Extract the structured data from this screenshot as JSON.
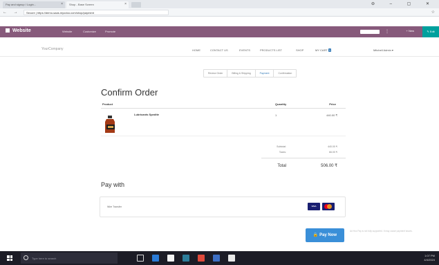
{
  "browser": {
    "tabs": [
      {
        "label": "Pay and signup / Login..."
      },
      {
        "label": "Shop - Base Screen"
      }
    ],
    "nav_buttons": "←  →  ⟳",
    "address": "Secure | https://demo-saas.myodoo.com/shop/payment",
    "window_controls": "⊖  –  ▢  ✕"
  },
  "odoo_bar": {
    "app_name": "Website",
    "menus": [
      "Website",
      "Customize",
      "Promote"
    ],
    "new_label": "+ New",
    "edit_label": "✎ Edit"
  },
  "site": {
    "logo": "YourCompany",
    "nav": [
      "Home",
      "Contact us",
      "Events",
      "Products List",
      "Shop"
    ],
    "cart_label": "My Cart",
    "cart_count": "1",
    "user_menu": "Mitchell Admin ▾"
  },
  "steps": [
    "Review Order",
    "Billing & Shipping",
    "Payment",
    "Confirmation"
  ],
  "active_step": 2,
  "page_title": "Confirm Order",
  "table": {
    "headers": [
      "Product",
      "Quantity",
      "Price"
    ],
    "rows": [
      {
        "product": "Lubricants Spedite",
        "quantity": "1",
        "price": "440.00 ₹"
      }
    ]
  },
  "summary": {
    "subtotal_label": "Subtotal:",
    "subtotal_value": "440.00 ₹",
    "taxes_label": "Taxes:",
    "taxes_value": "66.00 ₹",
    "total_label": "Total",
    "total_value": "506.00 ₹"
  },
  "pay": {
    "title": "Pay with",
    "method": "Wire Transfer",
    "button": "Pay Now",
    "note": "Ad Hoc Pay is not fully supported. It may cause payment issues."
  },
  "taskbar": {
    "search_placeholder": "Type here to search",
    "clock_time": "1:07 PM",
    "clock_date": "4/4/2024"
  },
  "colors": {
    "odoo_purple": "#875a7b",
    "teal": "#00a09d",
    "primary_blue": "#3a8fd8",
    "taskbar": "#1c1c26"
  }
}
